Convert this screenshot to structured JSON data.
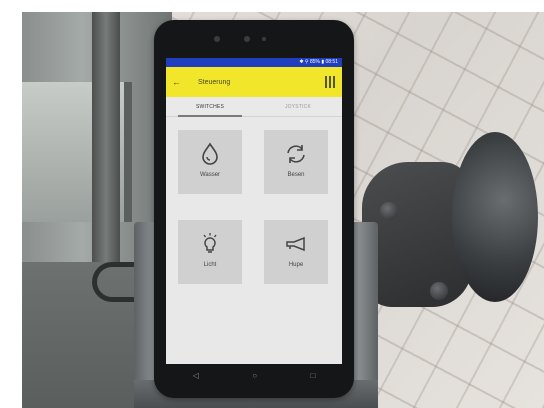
{
  "phone_app": {
    "status_text": "✱ ⚲ 85% ▮ 08:51",
    "back_icon": "back-arrow-icon",
    "title": "Steuerung",
    "menu_icon": "more-vert-icon",
    "tabs": [
      {
        "label": "SWITCHES",
        "active": true
      },
      {
        "label": "JOYSTICK",
        "active": false
      }
    ],
    "tiles": [
      {
        "label": "Wasser",
        "icon": "water-drop-icon"
      },
      {
        "label": "Besen",
        "icon": "sync-icon"
      },
      {
        "label": "Licht",
        "icon": "light-bulb-icon"
      },
      {
        "label": "Hupe",
        "icon": "horn-icon"
      }
    ],
    "nav_buttons": [
      {
        "symbol": "◁",
        "icon": "back-nav-icon"
      },
      {
        "symbol": "○",
        "icon": "home-nav-icon"
      },
      {
        "symbol": "□",
        "icon": "recents-nav-icon"
      }
    ]
  },
  "colors": {
    "appbar": "#f2e62a",
    "statusbar": "#1f3fbf",
    "tile": "#d0d0d0",
    "screen_bg": "#e8e8e8"
  }
}
